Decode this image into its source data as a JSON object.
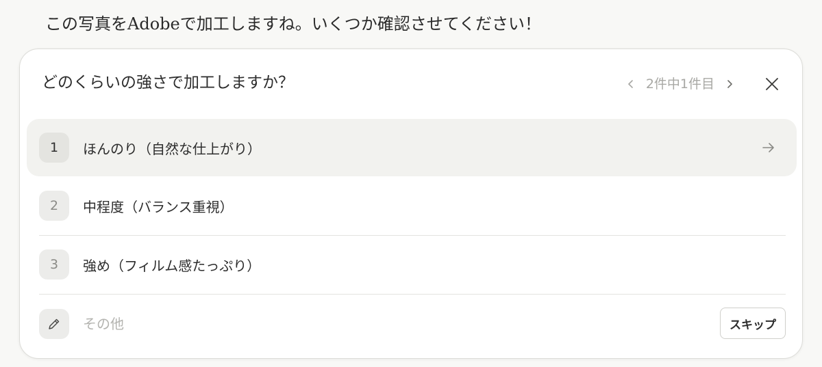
{
  "chat": {
    "assistant_message": "この写真をAdobeで加工しますね。いくつか確認させてください！"
  },
  "question_card": {
    "question": "どのくらいの強さで加工しますか？",
    "pager": {
      "text": "2件中1件目",
      "prev_icon": "chevron-left-icon",
      "next_icon": "chevron-right-icon"
    },
    "close_icon": "close-icon",
    "options": [
      {
        "number": "1",
        "label": "ほんのり（自然な仕上がり）",
        "selected": true,
        "icon": "arrow-right-icon"
      },
      {
        "number": "2",
        "label": "中程度（バランス重視）",
        "selected": false
      },
      {
        "number": "3",
        "label": "強め（フィルム感たっぷり）",
        "selected": false
      }
    ],
    "other": {
      "icon": "pencil-icon",
      "placeholder": "その他",
      "value": ""
    },
    "skip_label": "スキップ"
  },
  "colors": {
    "page_background": "#f8f8f6",
    "card_background": "#ffffff",
    "selected_row": "#f2f2ef",
    "muted_text": "#a8a8a4"
  }
}
